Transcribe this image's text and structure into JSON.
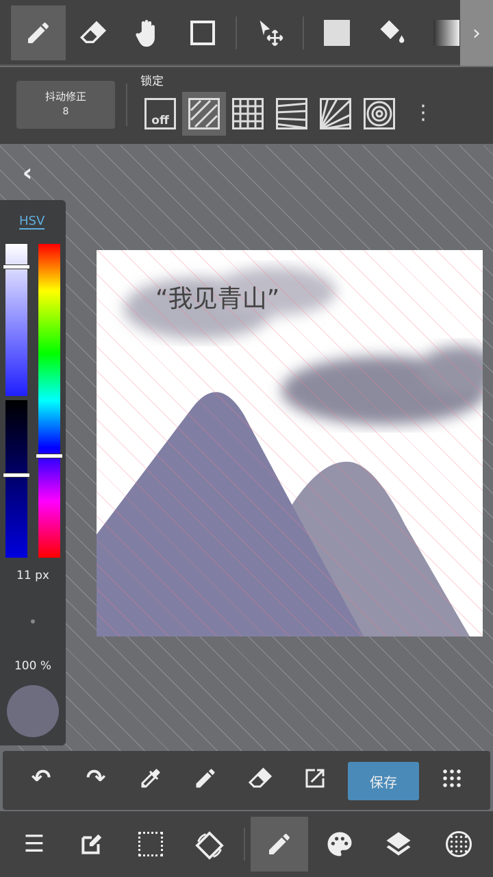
{
  "toolbar": {
    "tools": [
      "pen",
      "eraser",
      "hand",
      "rectangle",
      "move-select",
      "fill-color",
      "bucket",
      "gradient"
    ],
    "active": "pen"
  },
  "subbar": {
    "stabilizer_label": "抖动修正",
    "stabilizer_value": "8",
    "lock_label": "锁定",
    "off_label": "off",
    "rulers": [
      "off",
      "parallel",
      "grid",
      "perspective",
      "radial",
      "concentric"
    ],
    "active_ruler": "parallel"
  },
  "color_panel": {
    "mode": "HSV",
    "brush_size": "11 px",
    "opacity": "100 %",
    "current_color": "#6e6d80",
    "saturation_slider": 0.08,
    "value_slider": 0.48,
    "hue_slider": 0.68
  },
  "artwork": {
    "title_text": "“我见青山”"
  },
  "actions": {
    "save_label": "保存",
    "accent": "#4a8ab8"
  },
  "bottom_nav": [
    "menu",
    "edit",
    "selection",
    "rotate",
    "brush",
    "palette",
    "layers",
    "materials"
  ]
}
